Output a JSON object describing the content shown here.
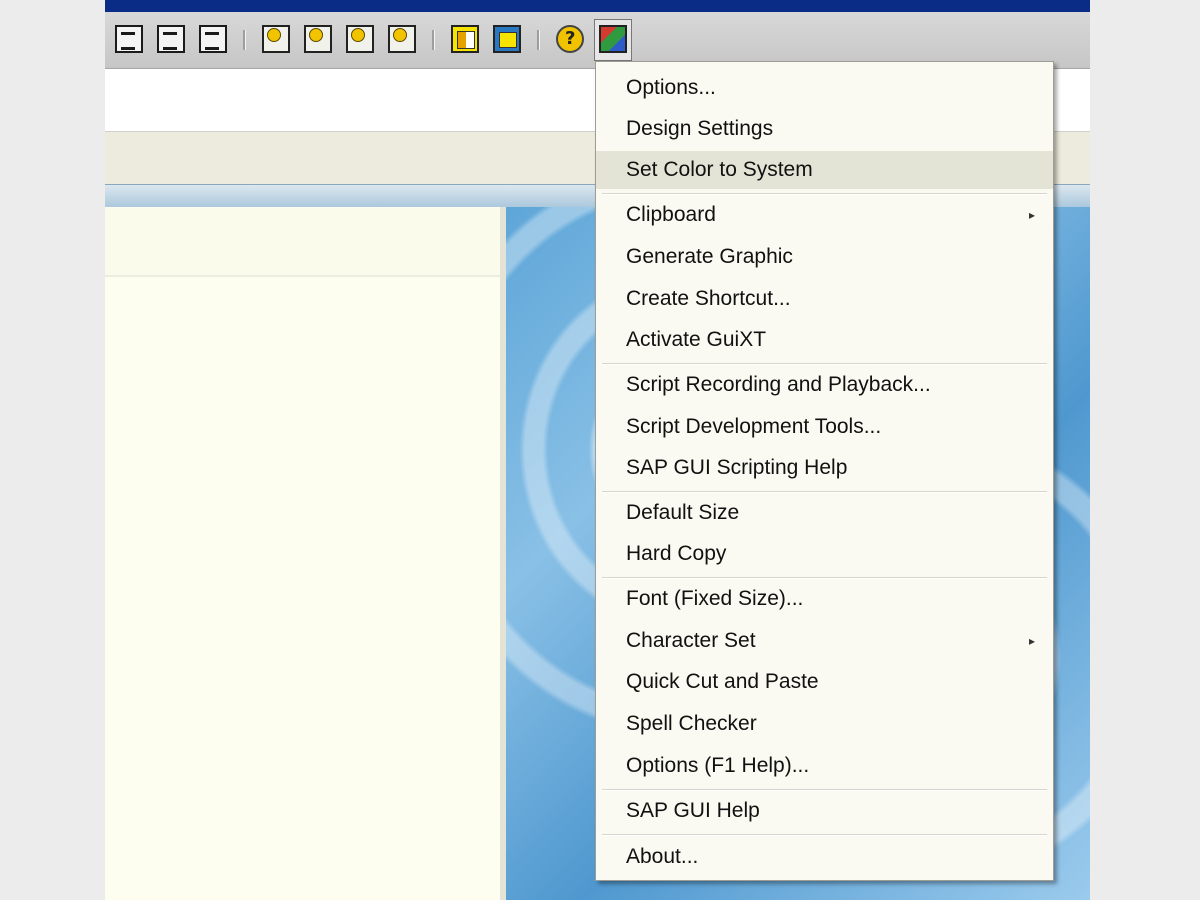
{
  "toolbar": {
    "icons": [
      {
        "name": "print-icon"
      },
      {
        "name": "find-icon"
      },
      {
        "name": "find-next-icon"
      },
      {
        "name": "first-page-icon"
      },
      {
        "name": "previous-page-icon"
      },
      {
        "name": "next-page-icon"
      },
      {
        "name": "last-page-icon"
      },
      {
        "name": "create-session-icon"
      },
      {
        "name": "shortcut-icon"
      },
      {
        "name": "help-icon"
      },
      {
        "name": "customize-layout-icon"
      }
    ]
  },
  "menu": {
    "items": [
      {
        "label": "Options..."
      },
      {
        "label": "Design Settings"
      },
      {
        "label": "Set Color to System",
        "highlighted": true
      },
      {
        "label": "Clipboard",
        "submenu": true
      },
      {
        "label": "Generate Graphic"
      },
      {
        "label": "Create Shortcut..."
      },
      {
        "label": "Activate GuiXT"
      },
      {
        "label": "Script Recording and Playback..."
      },
      {
        "label": "Script Development Tools..."
      },
      {
        "label": "SAP GUI Scripting Help"
      },
      {
        "label": "Default Size"
      },
      {
        "label": "Hard Copy"
      },
      {
        "label": "Font (Fixed Size)..."
      },
      {
        "label": "Character Set",
        "submenu": true
      },
      {
        "label": "Quick Cut and Paste"
      },
      {
        "label": "Spell Checker"
      },
      {
        "label": "Options (F1 Help)..."
      },
      {
        "label": "SAP GUI Help"
      },
      {
        "label": "About..."
      }
    ],
    "submenu_arrow": "▸"
  }
}
